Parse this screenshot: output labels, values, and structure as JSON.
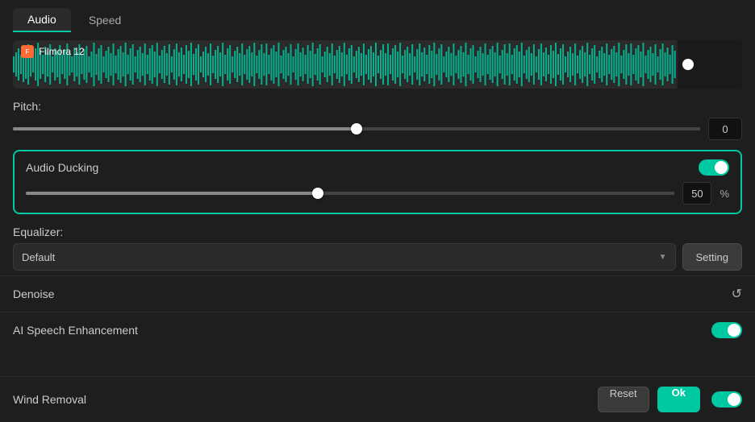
{
  "tabs": [
    {
      "id": "audio",
      "label": "Audio",
      "active": true
    },
    {
      "id": "speed",
      "label": "Speed",
      "active": false
    }
  ],
  "waveform": {
    "filename": "Filmora 12",
    "icon_label": "F"
  },
  "pitch": {
    "label": "Pitch:",
    "value": "0",
    "slider_percent": 50
  },
  "audio_ducking": {
    "label": "Audio Ducking",
    "enabled": true,
    "value": "50",
    "percent_label": "%",
    "slider_percent": 45
  },
  "equalizer": {
    "label": "Equalizer:",
    "selected": "Default",
    "setting_label": "Setting"
  },
  "denoise": {
    "label": "Denoise"
  },
  "ai_speech": {
    "label": "AI Speech Enhancement",
    "enabled": true
  },
  "wind_removal": {
    "label": "Wind Removal",
    "enabled": true
  },
  "buttons": {
    "reset": "Reset",
    "ok": "Ok"
  },
  "colors": {
    "accent": "#00c8a0"
  }
}
